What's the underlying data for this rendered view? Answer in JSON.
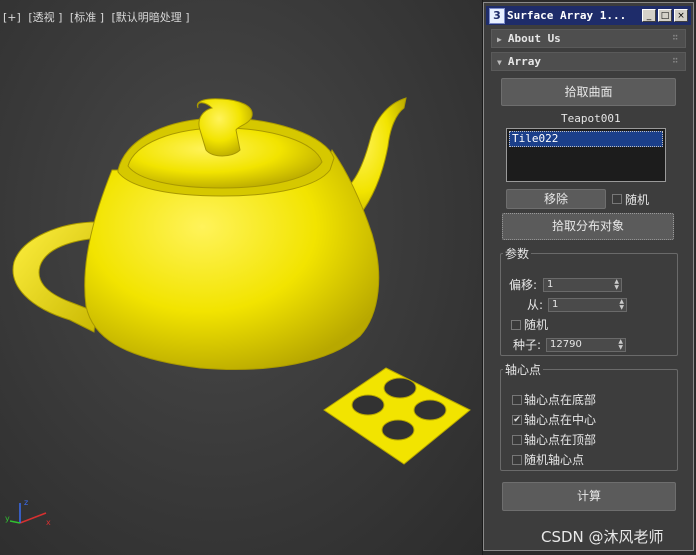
{
  "viewport": {
    "labels": [
      "[+]",
      "[透视 ]",
      "[标准 ]",
      "[默认明暗处理 ]"
    ],
    "axis": {
      "x": "x",
      "y": "y",
      "z": "z"
    },
    "watermark": "CSDN @沐风老师"
  },
  "window": {
    "app_icon": "3",
    "title": "Surface Array 1...",
    "min_glyph": "_",
    "max_glyph": "□",
    "close_glyph": "×"
  },
  "rollouts": {
    "about": {
      "label": "About Us",
      "arrow": "▶",
      "dots": "∷"
    },
    "array": {
      "label": "Array",
      "arrow": "▼",
      "dots": "∷"
    }
  },
  "array": {
    "pick_surface": "拾取曲面",
    "surface_name": "Teapot001",
    "items": [
      "Tile022"
    ],
    "remove": "移除",
    "random_label": "随机",
    "pick_distribution": "拾取分布对象"
  },
  "params": {
    "title": "参数",
    "offset_label": "偏移:",
    "offset_value": "1",
    "from_label": "从:",
    "from_value": "1",
    "random_label": "随机",
    "seed_label": "种子:",
    "seed_value": "12790"
  },
  "pivot": {
    "title": "轴心点",
    "options": [
      {
        "label": "轴心点在底部",
        "checked": false
      },
      {
        "label": "轴心点在中心",
        "checked": true
      },
      {
        "label": "轴心点在顶部",
        "checked": false
      },
      {
        "label": "随机轴心点",
        "checked": false
      }
    ]
  },
  "compute": "计算",
  "colors": {
    "teapot": "#f2e400",
    "titlebar": "#1e2c6a"
  }
}
